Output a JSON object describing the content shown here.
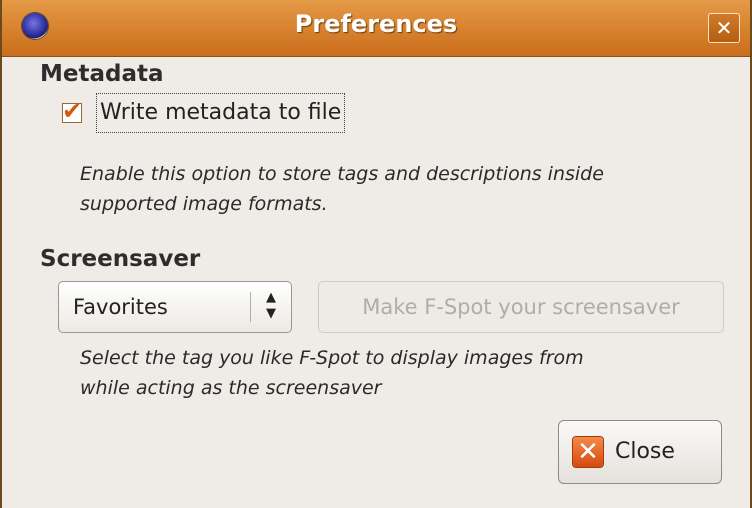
{
  "window": {
    "title": "Preferences",
    "close_glyph": "✕"
  },
  "metadata": {
    "heading": "Metadata",
    "checkbox_checked": true,
    "checkbox_label": "Write metadata to file",
    "help_line1": "Enable this option to store tags and descriptions inside",
    "help_line2": "supported image formats."
  },
  "screensaver": {
    "heading": "Screensaver",
    "selected_tag": "Favorites",
    "make_button_label": "Make F-Spot your screensaver",
    "help_line1": "Select the tag you like F-Spot to display images from",
    "help_line2": "while acting as the screensaver"
  },
  "footer": {
    "close_label": "Close"
  },
  "icons": {
    "app_icon": "fspot-app-icon",
    "close_icon": "close-x-icon",
    "combo_arrows": "updown-arrows-icon"
  },
  "colors": {
    "titlebar": "#d8832f",
    "window_bg": "#efebe7",
    "check_mark": "#d65a0b"
  }
}
